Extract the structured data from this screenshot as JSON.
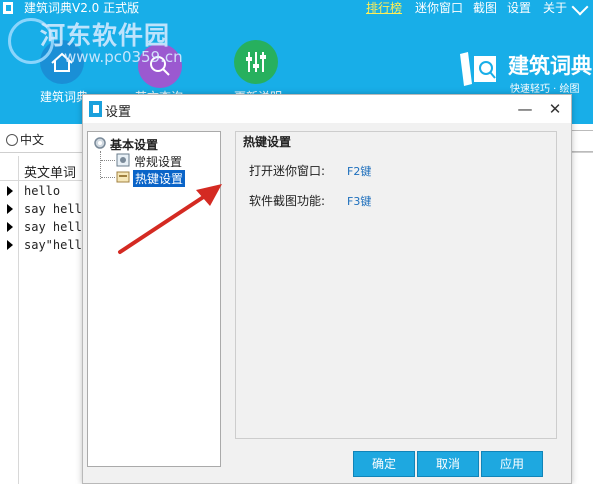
{
  "app": {
    "title": "建筑词典V2.0 正式版",
    "menu": [
      "排行榜",
      "迷你窗口",
      "截图",
      "设置",
      "关于"
    ],
    "nav": [
      {
        "label": "建筑词典",
        "icon": "home-icon",
        "color": "#1a8fd6"
      },
      {
        "label": "英文查询",
        "icon": "search-icon",
        "color": "#9b59d0"
      },
      {
        "label": "更新说明",
        "icon": "sliders-icon",
        "color": "#27b05e"
      }
    ],
    "brand_name": "建筑词典",
    "brand_tagline": "快速轻巧 · 绘图",
    "watermark_text": "河东软件园",
    "watermark_url": "www.pc0359.cn",
    "search_option": "中文",
    "column_header": "英文单词",
    "rows": [
      "hello",
      "say hell",
      "say hell",
      "say\"hell"
    ],
    "accent_color": "#18aee8"
  },
  "dialog": {
    "title": "设置",
    "tree": {
      "root": "基本设置",
      "children": [
        "常规设置",
        "热键设置"
      ],
      "selected": "热键设置"
    },
    "group_title": "热键设置",
    "hotkeys": [
      {
        "label": "打开迷你窗口:",
        "value": "F2键"
      },
      {
        "label": "软件截图功能:",
        "value": "F3键"
      }
    ],
    "buttons": {
      "ok": "确定",
      "cancel": "取消",
      "apply": "应用"
    },
    "button_color": "#1ea8e0"
  }
}
